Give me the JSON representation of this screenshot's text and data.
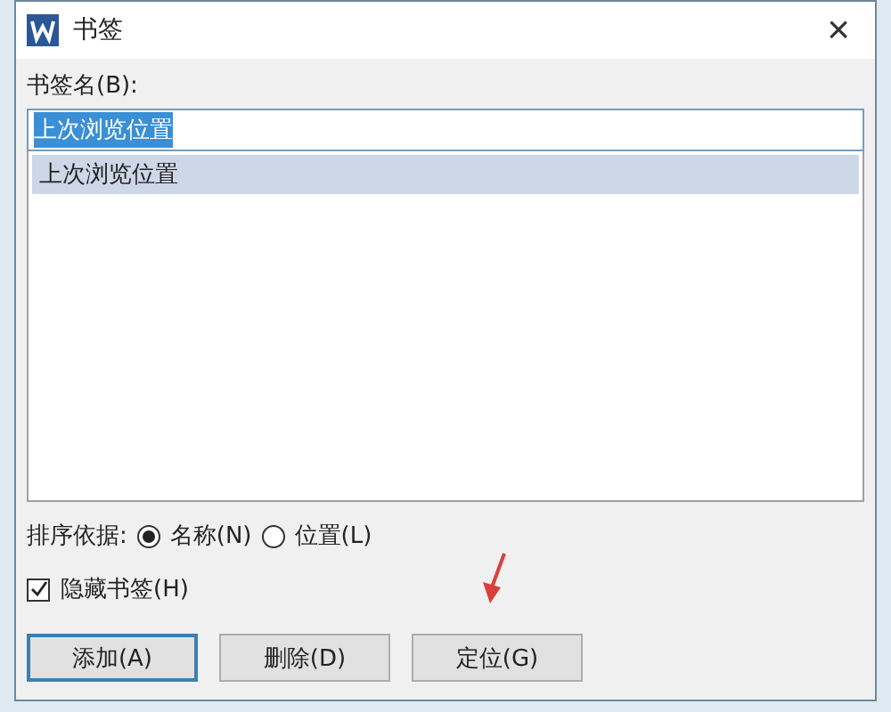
{
  "window": {
    "title": "书签",
    "close": "×"
  },
  "name_field": {
    "label": "书签名(B):",
    "value": "上次浏览位置"
  },
  "bookmarks": [
    {
      "label": "上次浏览位置",
      "selected": true
    }
  ],
  "sort": {
    "label": "排序依据:",
    "options": [
      {
        "label": "名称(N)",
        "selected": true
      },
      {
        "label": "位置(L)",
        "selected": false
      }
    ]
  },
  "hide_bookmarks": {
    "label": "隐藏书签(H)",
    "checked": true
  },
  "buttons": [
    {
      "label": "添加(A)",
      "default": true
    },
    {
      "label": "删除(D)",
      "default": false
    },
    {
      "label": "定位(G)",
      "default": false
    }
  ],
  "annotation": {
    "kind": "arrow"
  }
}
